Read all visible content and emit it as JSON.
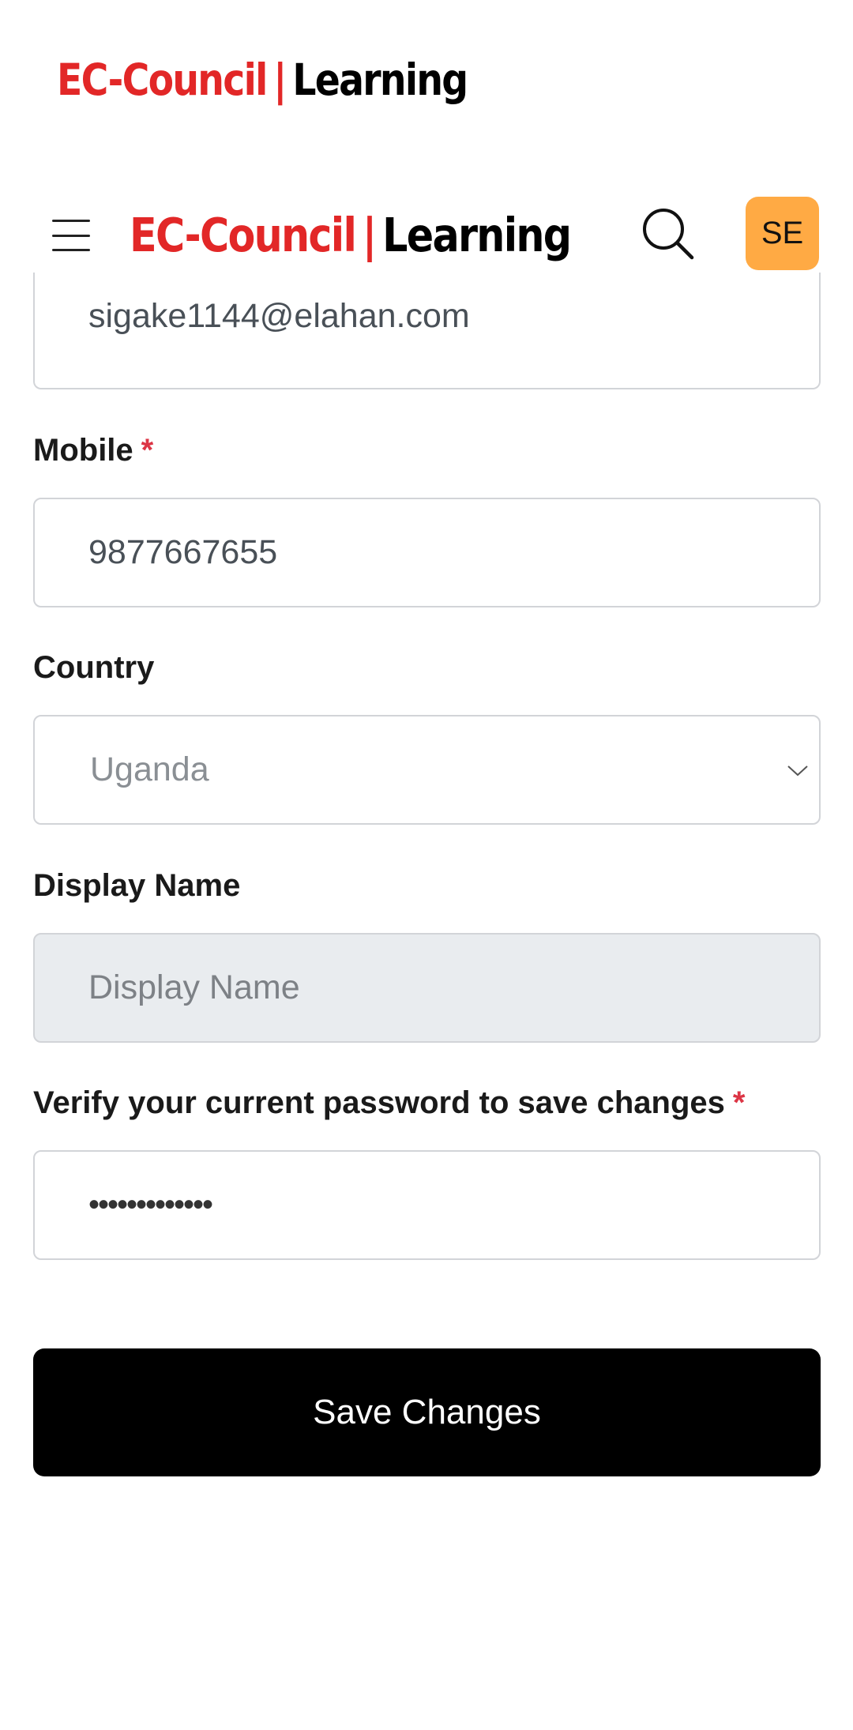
{
  "brand": {
    "name_red": "EC-Council",
    "separator": "|",
    "name_black": "Learning",
    "red_color": "#e22727"
  },
  "header": {
    "menu_icon": "hamburger-menu-icon",
    "search_icon": "search-icon",
    "avatar_initials": "SE",
    "avatar_color": "#ffaa44"
  },
  "form": {
    "email": {
      "value": "sigake1144@elahan.com"
    },
    "mobile": {
      "label": "Mobile",
      "required_mark": "*",
      "value": "9877667655"
    },
    "country": {
      "label": "Country",
      "selected": "Uganda"
    },
    "display_name": {
      "label": "Display Name",
      "placeholder": "Display Name"
    },
    "password": {
      "label": "Verify your current password to save changes",
      "required_mark": "*",
      "masked_value": "•••••••••••••"
    },
    "save_label": "Save Changes"
  }
}
